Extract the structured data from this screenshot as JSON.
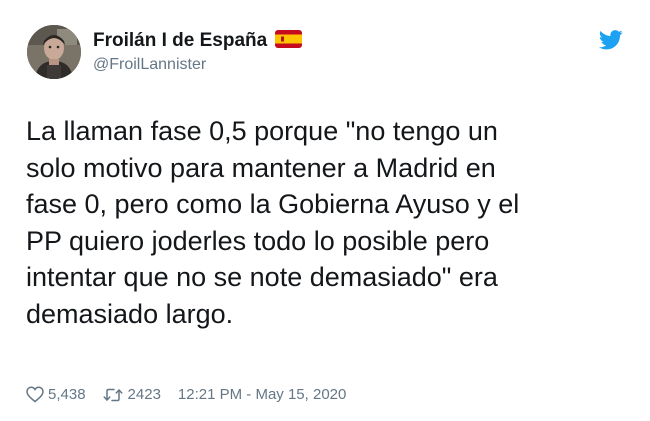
{
  "user": {
    "display_name": "Froilán I de España",
    "handle": "@FroilLannister",
    "flag_icon": "spain-flag-icon"
  },
  "brand_icon": "twitter-bird-icon",
  "tweet": {
    "text": "La llaman fase 0,5 porque \"no tengo un\nsolo motivo para mantener a Madrid en\nfase 0, pero como la Gobierna Ayuso y el\nPP quiero joderles todo lo posible pero\nintentar que no se note demasiado\" era\ndemasiado largo."
  },
  "stats": {
    "likes": "5,438",
    "retweets": "2423",
    "timestamp": "12:21 PM - May 15, 2020"
  },
  "colors": {
    "text": "#14171a",
    "secondary": "#657786",
    "twitter_blue": "#1da1f2",
    "flag_red": "#c60b1e",
    "flag_yellow": "#ffc400"
  }
}
